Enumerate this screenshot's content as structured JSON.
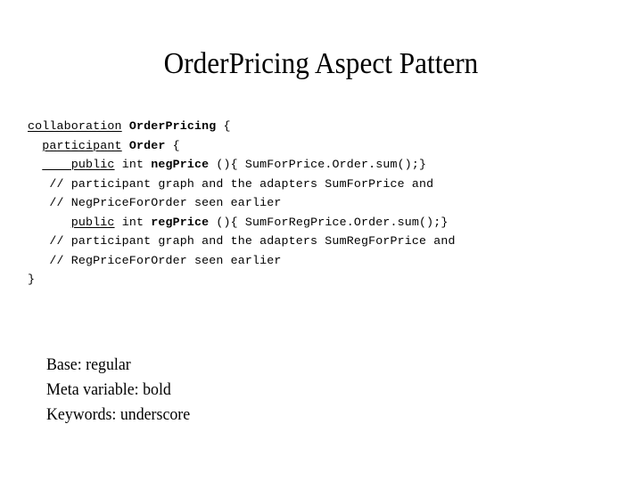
{
  "slide": {
    "title": "OrderPricing Aspect Pattern",
    "background_color": "#ffffff",
    "text_color": "#000000"
  },
  "code": {
    "lines": [
      {
        "id": "line-1",
        "segments": [
          {
            "text": "collaboration",
            "style": "keyword-underscore"
          },
          {
            "text": " ",
            "style": "base"
          },
          {
            "text": "OrderPricing",
            "style": "meta-bold"
          },
          {
            "text": " {",
            "style": "base"
          }
        ]
      },
      {
        "id": "line-2",
        "segments": [
          {
            "text": "  ",
            "style": "base"
          },
          {
            "text": "participant",
            "style": "keyword-underscore"
          },
          {
            "text": " ",
            "style": "base"
          },
          {
            "text": "Order",
            "style": "meta-bold"
          },
          {
            "text": " {",
            "style": "base"
          }
        ]
      },
      {
        "id": "line-3",
        "segments": [
          {
            "text": "  ",
            "style": "base"
          },
          {
            "text": "    public",
            "style": "keyword-underscore"
          },
          {
            "text": " int ",
            "style": "base"
          },
          {
            "text": "negPrice",
            "style": "meta-bold"
          },
          {
            "text": " (){ SumForPrice.Order.sum();}",
            "style": "base"
          }
        ]
      },
      {
        "id": "line-4",
        "segments": [
          {
            "text": "   // participant graph and the adapters SumForPrice and",
            "style": "base"
          }
        ]
      },
      {
        "id": "line-5",
        "segments": [
          {
            "text": "   // NegPriceForOrder seen earlier",
            "style": "base"
          }
        ]
      },
      {
        "id": "line-6",
        "segments": [
          {
            "text": "      ",
            "style": "base"
          },
          {
            "text": "public",
            "style": "keyword-underscore"
          },
          {
            "text": " int ",
            "style": "base"
          },
          {
            "text": "regPrice",
            "style": "meta-bold"
          },
          {
            "text": " (){ SumForRegPrice.Order.sum();}",
            "style": "base"
          }
        ]
      },
      {
        "id": "line-7",
        "segments": [
          {
            "text": "   // participant graph and the adapters SumRegForPrice and",
            "style": "base"
          }
        ]
      },
      {
        "id": "line-8",
        "segments": [
          {
            "text": "   // RegPriceForOrder seen earlier",
            "style": "base"
          }
        ]
      },
      {
        "id": "line-9",
        "segments": [
          {
            "text": "}",
            "style": "base"
          }
        ]
      }
    ]
  },
  "legend": {
    "items": [
      "Base: regular",
      "Meta variable: bold",
      "Keywords: underscore"
    ]
  }
}
